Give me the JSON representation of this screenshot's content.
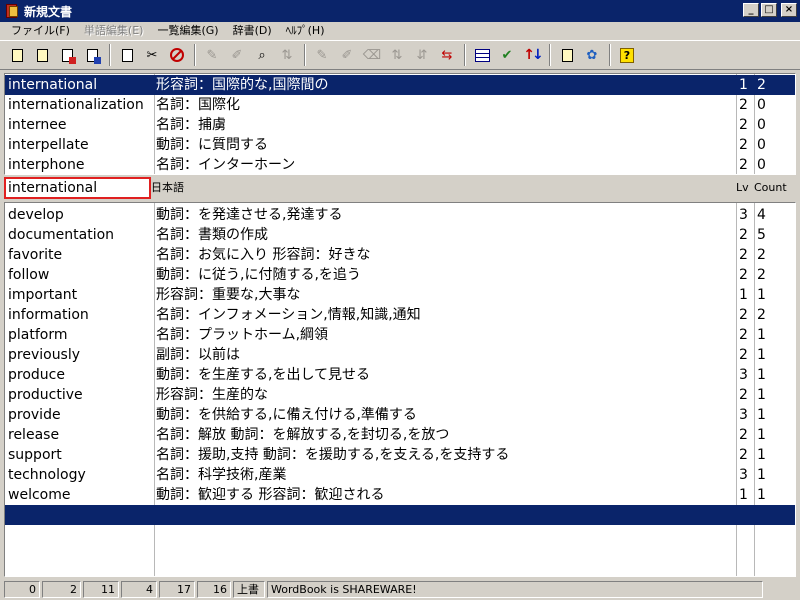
{
  "window": {
    "title": "新規文書"
  },
  "menu": [
    {
      "label": "ファイル(F)",
      "enabled": true
    },
    {
      "label": "単語編集(E)",
      "enabled": false
    },
    {
      "label": "一覧編集(G)",
      "enabled": true
    },
    {
      "label": "辞書(D)",
      "enabled": true
    },
    {
      "label": "ﾍﾙﾌﾟ(H)",
      "enabled": true
    }
  ],
  "toolbar_icons": [
    "new-doc-icon",
    "open-doc-icon",
    "save-red-icon",
    "save-blue-icon",
    "page-icon",
    "tools-icon",
    "stop-icon",
    "add-word-icon",
    "edit-word-icon",
    "find-word-icon",
    "sort-word-icon",
    "list-add-icon",
    "list-edit-icon",
    "list-delete-icon",
    "list-sort-icon",
    "list-filter-icon",
    "list-move-icon",
    "table-icon",
    "test-icon",
    "sort-updown-icon",
    "dictionary-icon",
    "quiz-icon",
    "help-icon"
  ],
  "search": {
    "value": "international"
  },
  "columns": {
    "meaning": "日本語",
    "lv": "Lv",
    "count": "Count"
  },
  "top_list": [
    {
      "word": "international",
      "meaning": "形容詞：国際的な,国際間の",
      "lv": "1",
      "count": "2",
      "selected": true
    },
    {
      "word": "internationalization",
      "meaning": "名詞：国際化",
      "lv": "2",
      "count": "0"
    },
    {
      "word": "internee",
      "meaning": "名詞：捕虜",
      "lv": "2",
      "count": "0"
    },
    {
      "word": "interpellate",
      "meaning": "動詞：に質問する",
      "lv": "2",
      "count": "0"
    },
    {
      "word": "interphone",
      "meaning": "名詞：インターホーン",
      "lv": "2",
      "count": "0"
    }
  ],
  "bottom_list": [
    {
      "word": "develop",
      "meaning": "動詞：を発達させる,発達する",
      "lv": "3",
      "count": "4"
    },
    {
      "word": "documentation",
      "meaning": "名詞：書類の作成",
      "lv": "2",
      "count": "5"
    },
    {
      "word": "favorite",
      "meaning": "名詞：お気に入り 形容詞：好きな",
      "lv": "2",
      "count": "2"
    },
    {
      "word": "follow",
      "meaning": "動詞：に従う,に付随する,を追う",
      "lv": "2",
      "count": "2"
    },
    {
      "word": "important",
      "meaning": "形容詞：重要な,大事な",
      "lv": "1",
      "count": "1"
    },
    {
      "word": "information",
      "meaning": "名詞：インフォメーション,情報,知識,通知",
      "lv": "2",
      "count": "2"
    },
    {
      "word": "platform",
      "meaning": "名詞：プラットホーム,綱領",
      "lv": "2",
      "count": "1"
    },
    {
      "word": "previously",
      "meaning": "副詞：以前は",
      "lv": "2",
      "count": "1"
    },
    {
      "word": "produce",
      "meaning": "動詞：を生産する,を出して見せる",
      "lv": "3",
      "count": "1"
    },
    {
      "word": "productive",
      "meaning": "形容詞：生産的な",
      "lv": "2",
      "count": "1"
    },
    {
      "word": "provide",
      "meaning": "動詞：を供給する,に備え付ける,準備する",
      "lv": "3",
      "count": "1"
    },
    {
      "word": "release",
      "meaning": "名詞：解放 動詞：を解放する,を封切る,を放つ",
      "lv": "2",
      "count": "1"
    },
    {
      "word": "support",
      "meaning": "名詞：援助,支持 動詞：を援助する,を支える,を支持する",
      "lv": "2",
      "count": "1"
    },
    {
      "word": "technology",
      "meaning": "名詞：科学技術,産業",
      "lv": "3",
      "count": "1"
    },
    {
      "word": "welcome",
      "meaning": "動詞：歓迎する 形容詞：歓迎される",
      "lv": "1",
      "count": "1"
    },
    {
      "word": "",
      "meaning": "",
      "lv": "",
      "count": "",
      "selected": true
    }
  ],
  "status": {
    "s1": "0",
    "s2": "2",
    "s3": "11",
    "s4": "4",
    "s5": "17",
    "s6": "16",
    "mode": "上書",
    "message": "WordBook is SHAREWARE!"
  },
  "colors": {
    "titlebar": "#0a246a",
    "selection": "#0a246a",
    "search_border": "#e02020",
    "face": "#d4d0c8"
  }
}
